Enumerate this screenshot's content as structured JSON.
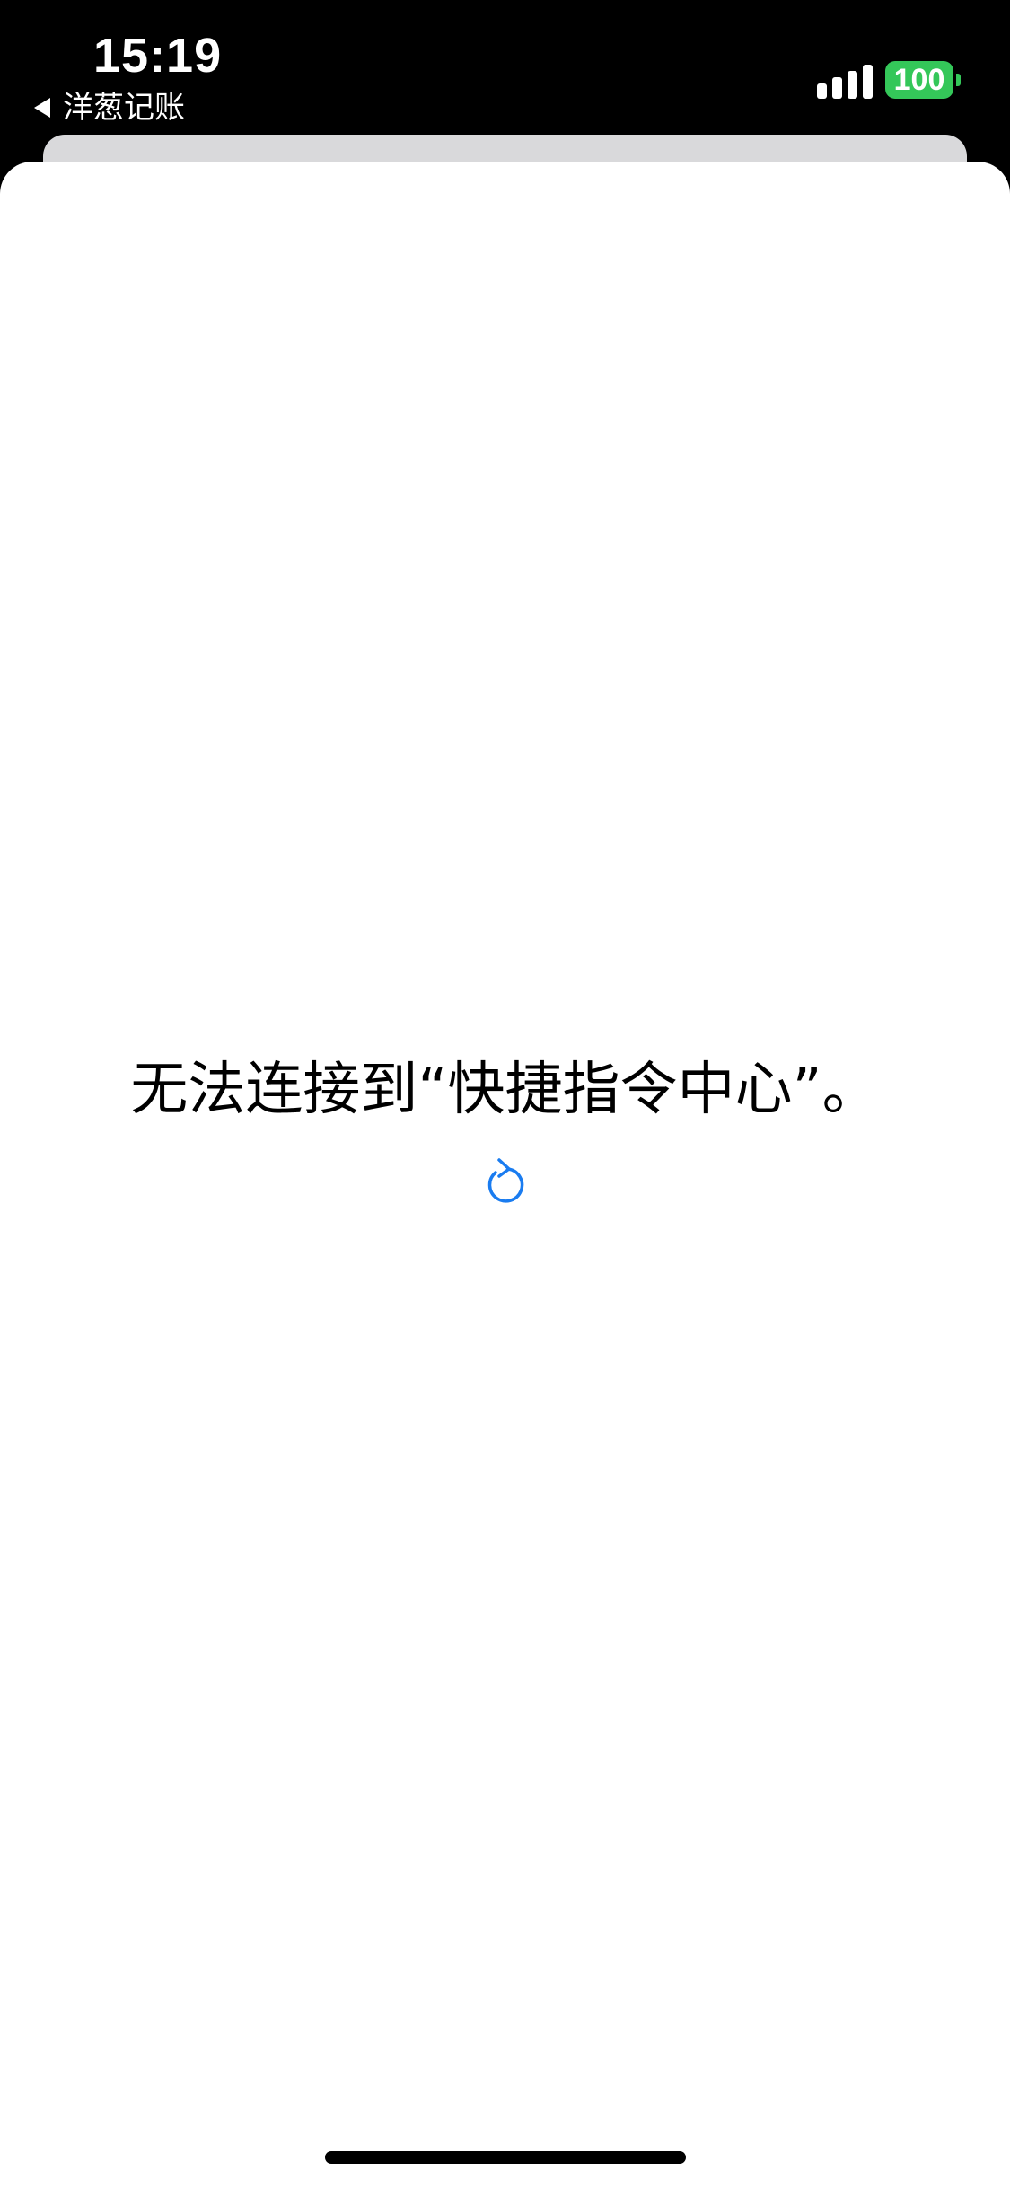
{
  "status_bar": {
    "time": "15:19",
    "back_app_label": "洋葱记账",
    "battery_level": "100",
    "signal_bars": 4,
    "battery_color": "#34c759"
  },
  "content": {
    "error_message": "无法连接到“快捷指令中心”。",
    "reload_icon": "reload-icon",
    "accent_color": "#1a7cf0"
  }
}
